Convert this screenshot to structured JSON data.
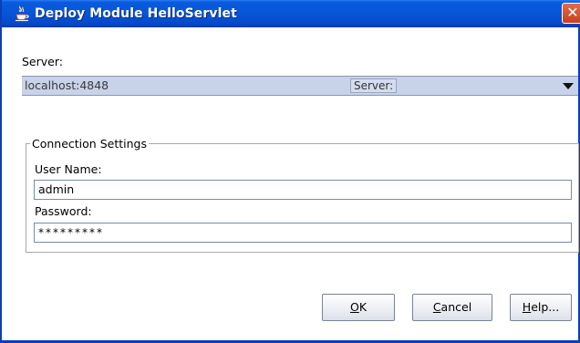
{
  "window": {
    "title": "Deploy Module HelloServlet",
    "close_glyph": "✕"
  },
  "server": {
    "label": "Server:",
    "selected": "localhost:4848",
    "tag": "Server:"
  },
  "connection": {
    "group_title": "Connection Settings",
    "user_label": "User Name:",
    "user_value": "admin",
    "password_label": "Password:",
    "password_value": "*********"
  },
  "buttons": {
    "ok_mnemonic": "O",
    "ok_rest": "K",
    "cancel_mnemonic": "C",
    "cancel_rest": "ancel",
    "help_mnemonic": "H",
    "help_rest": "elp..."
  },
  "colors": {
    "titlebar": "#0755d8",
    "close": "#c8401e",
    "combo_bg": "#c8d2e8"
  }
}
